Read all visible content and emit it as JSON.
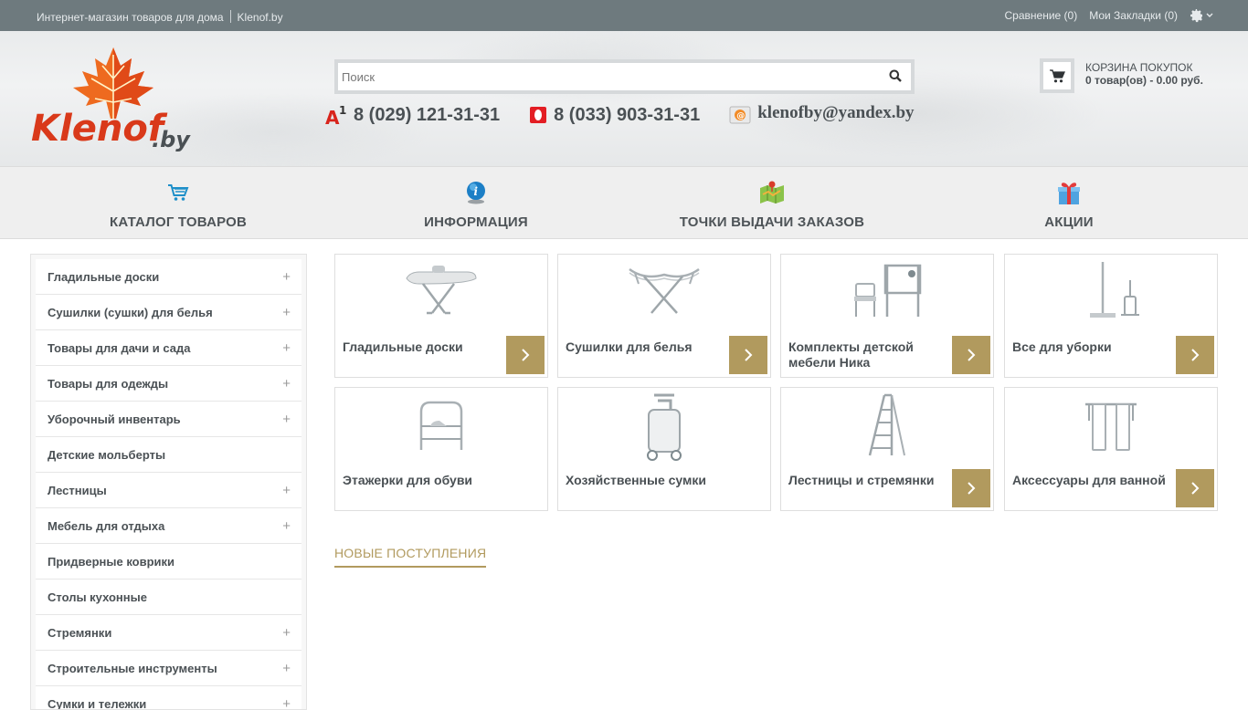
{
  "topbar": {
    "tagline": "Интернет-магазин товаров для дома",
    "site": "Klenof.by",
    "compare": "Сравнение (0)",
    "bookmarks": "Мои Закладки (0)"
  },
  "logo": {
    "text_main": "Klenof",
    "text_suffix": ".by"
  },
  "search": {
    "placeholder": "Поиск"
  },
  "contacts": {
    "phone1": "8 (029) 121-31-31",
    "phone1_icon": "a1-operator-icon",
    "phone2": "8 (033) 903-31-31",
    "phone2_icon": "mts-operator-icon",
    "email": "klenofby@yandex.by"
  },
  "cart": {
    "title": "КОРЗИНА ПОКУПОК",
    "summary": "0 товар(ов) - 0.00 руб."
  },
  "nav": [
    {
      "label": "КАТАЛОГ ТОВАРОВ",
      "icon": "cart-icon"
    },
    {
      "label": "ИНФОРМАЦИЯ",
      "icon": "info-icon"
    },
    {
      "label": "ТОЧКИ ВЫДАЧИ ЗАКАЗОВ",
      "icon": "map-icon"
    },
    {
      "label": "АКЦИИ",
      "icon": "gift-icon"
    }
  ],
  "sidebar": {
    "items": [
      {
        "label": "Гладильные доски",
        "expandable": "+"
      },
      {
        "label": "Сушилки (сушки) для белья",
        "expandable": "+"
      },
      {
        "label": "Товары для дачи и сада",
        "expandable": "+"
      },
      {
        "label": "Товары для одежды",
        "expandable": "+"
      },
      {
        "label": "Уборочный инвентарь",
        "expandable": "+"
      },
      {
        "label": "Детские мольберты",
        "expandable": ""
      },
      {
        "label": "Лестницы",
        "expandable": "+"
      },
      {
        "label": "Мебель для отдыха",
        "expandable": "+"
      },
      {
        "label": "Придверные коврики",
        "expandable": ""
      },
      {
        "label": "Столы кухонные",
        "expandable": ""
      },
      {
        "label": "Стремянки",
        "expandable": "+"
      },
      {
        "label": "Строительные инструменты",
        "expandable": "+"
      },
      {
        "label": "Сумки и тележки",
        "expandable": "+"
      }
    ]
  },
  "tiles": [
    {
      "label": "Гладильные доски",
      "icon": "ironing-board-icon",
      "has_button": true
    },
    {
      "label": "Сушилки для белья",
      "icon": "clothes-dryer-icon",
      "has_button": true
    },
    {
      "label": "Комплекты детской мебели Ника",
      "icon": "kids-furniture-icon",
      "has_button": true
    },
    {
      "label": "Все для уборки",
      "icon": "mop-icon",
      "has_button": true
    },
    {
      "label": "Этажерки для обуви",
      "icon": "shoe-rack-icon",
      "has_button": false
    },
    {
      "label": "Хозяйственные сумки",
      "icon": "shopping-trolley-icon",
      "has_button": false
    },
    {
      "label": "Лестницы и стремянки",
      "icon": "ladder-icon",
      "has_button": true
    },
    {
      "label": "Аксессуары для ванной",
      "icon": "bath-accessory-icon",
      "has_button": true
    }
  ],
  "new_arrivals": "НОВЫЕ ПОСТУПЛЕНИЯ",
  "colors": {
    "accent": "#b19a5e",
    "topbar": "#6e7a7e",
    "logo_orange": "#e8541c"
  }
}
